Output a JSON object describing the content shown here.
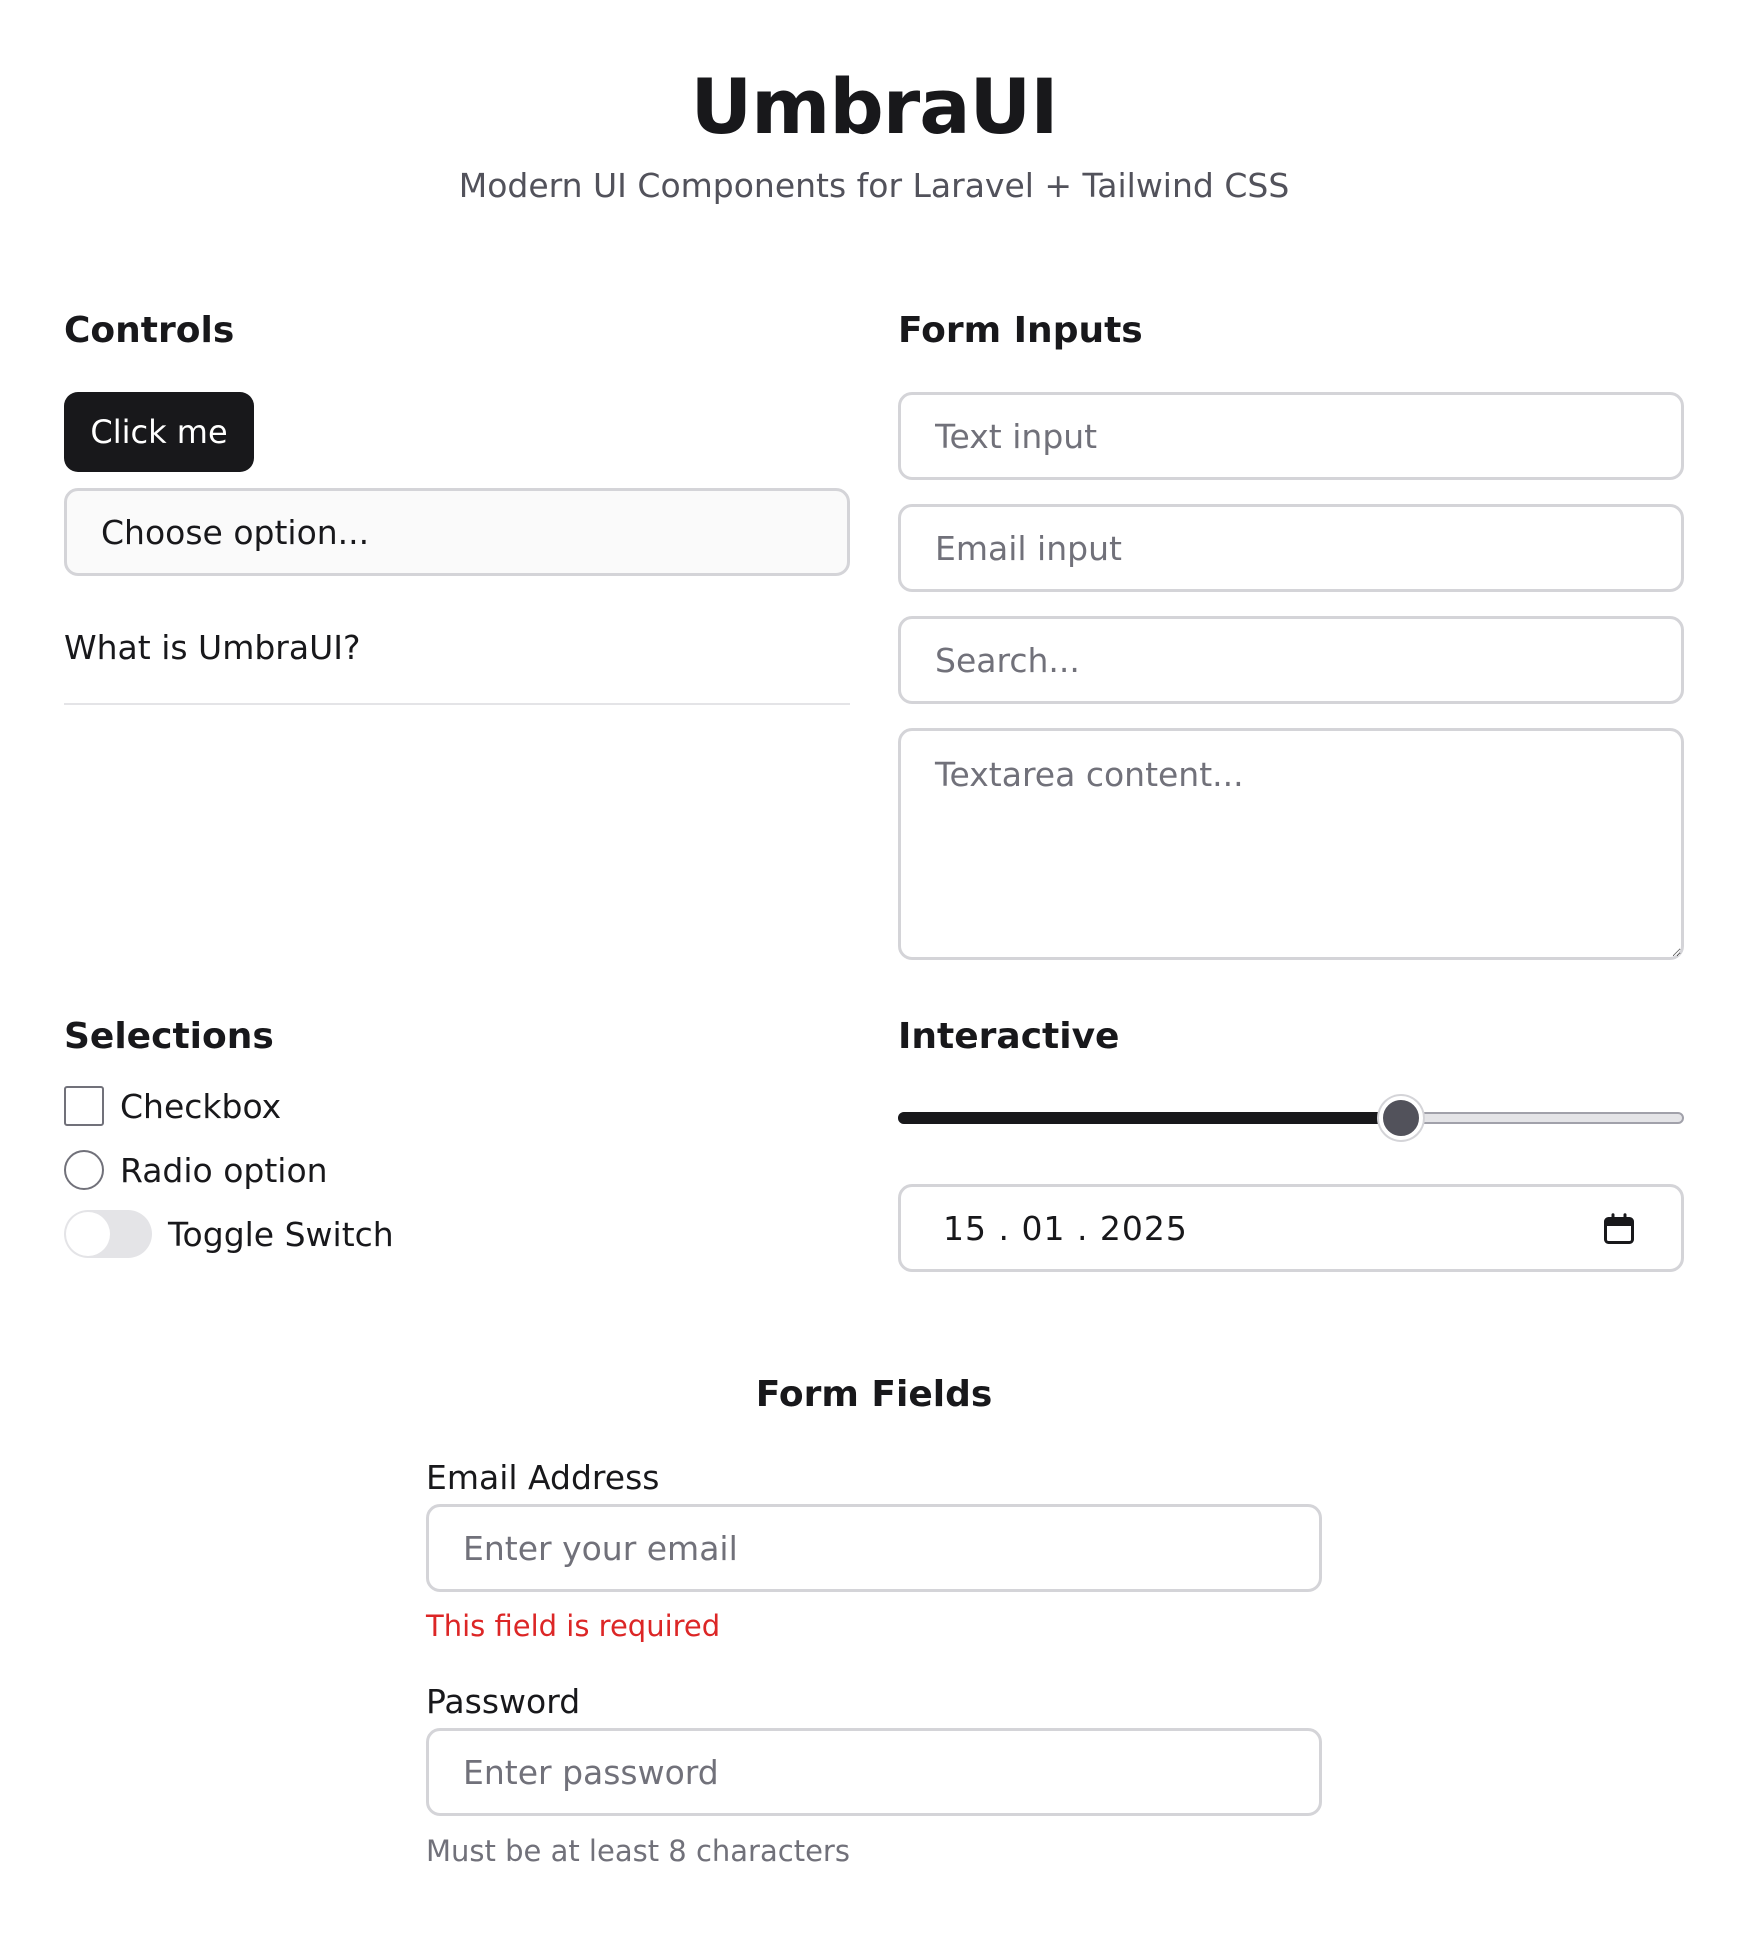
{
  "header": {
    "title": "UmbraUI",
    "subtitle": "Modern UI Components for Laravel + Tailwind CSS"
  },
  "controls": {
    "heading": "Controls",
    "button_label": "Click me",
    "select_value": "Choose option...",
    "accordion_title": "What is UmbraUI?"
  },
  "form_inputs": {
    "heading": "Form Inputs",
    "text_placeholder": "Text input",
    "email_placeholder": "Email input",
    "search_placeholder": "Search...",
    "textarea_placeholder": "Textarea content..."
  },
  "selections": {
    "heading": "Selections",
    "checkbox_label": "Checkbox",
    "checkbox_checked": false,
    "radio_label": "Radio option",
    "radio_checked": false,
    "toggle_label": "Toggle Switch",
    "toggle_on": false
  },
  "interactive": {
    "heading": "Interactive",
    "slider_value": 0.64,
    "date_value": "15 . 01 . 2025",
    "calendar_icon": "calendar-icon"
  },
  "form_fields": {
    "heading": "Form Fields",
    "email_label": "Email Address",
    "email_placeholder": "Enter your email",
    "email_error": "This field is required",
    "password_label": "Password",
    "password_placeholder": "Enter password",
    "password_hint": "Must be at least 8 characters"
  },
  "colors": {
    "primary": "#18181b",
    "error": "#dc2626",
    "muted": "#71717a",
    "border": "#d4d4d8"
  }
}
